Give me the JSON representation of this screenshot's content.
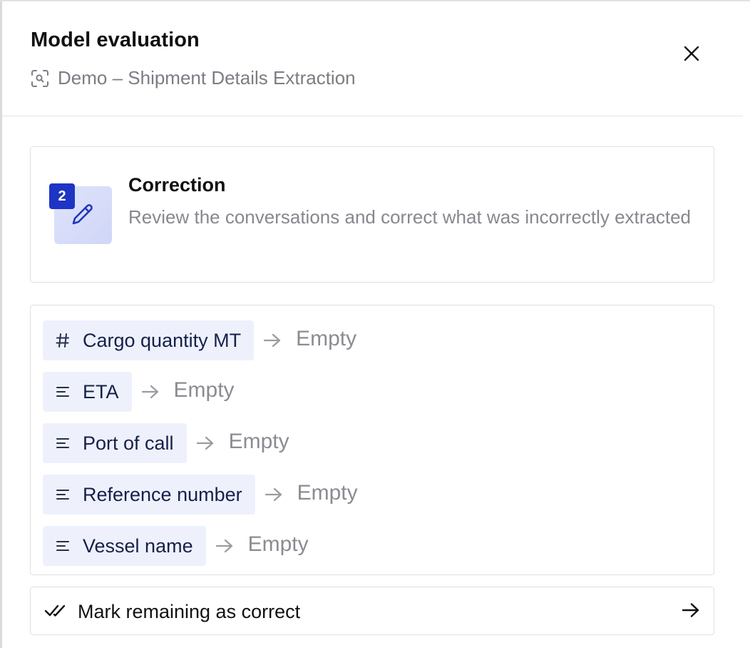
{
  "header": {
    "title": "Model evaluation",
    "subtitle": "Demo – Shipment Details Extraction",
    "subtitle_icon": "scan-search-icon",
    "close_icon": "close-icon"
  },
  "step": {
    "number": "2",
    "title": "Correction",
    "description": "Review the conversations and correct what was incorrectly extracted",
    "icon": "pencil-icon",
    "accent": "#1e34c4"
  },
  "fields": [
    {
      "label": "Cargo quantity MT",
      "type_icon": "hash-icon",
      "value": "Empty"
    },
    {
      "label": "ETA",
      "type_icon": "text-lines-icon",
      "value": "Empty"
    },
    {
      "label": "Port of call",
      "type_icon": "text-lines-icon",
      "value": "Empty"
    },
    {
      "label": "Reference number",
      "type_icon": "text-lines-icon",
      "value": "Empty"
    },
    {
      "label": "Vessel name",
      "type_icon": "text-lines-icon",
      "value": "Empty"
    }
  ],
  "footer": {
    "mark_label": "Mark remaining as correct",
    "check_icon": "double-check-icon",
    "go_icon": "arrow-right-icon"
  }
}
